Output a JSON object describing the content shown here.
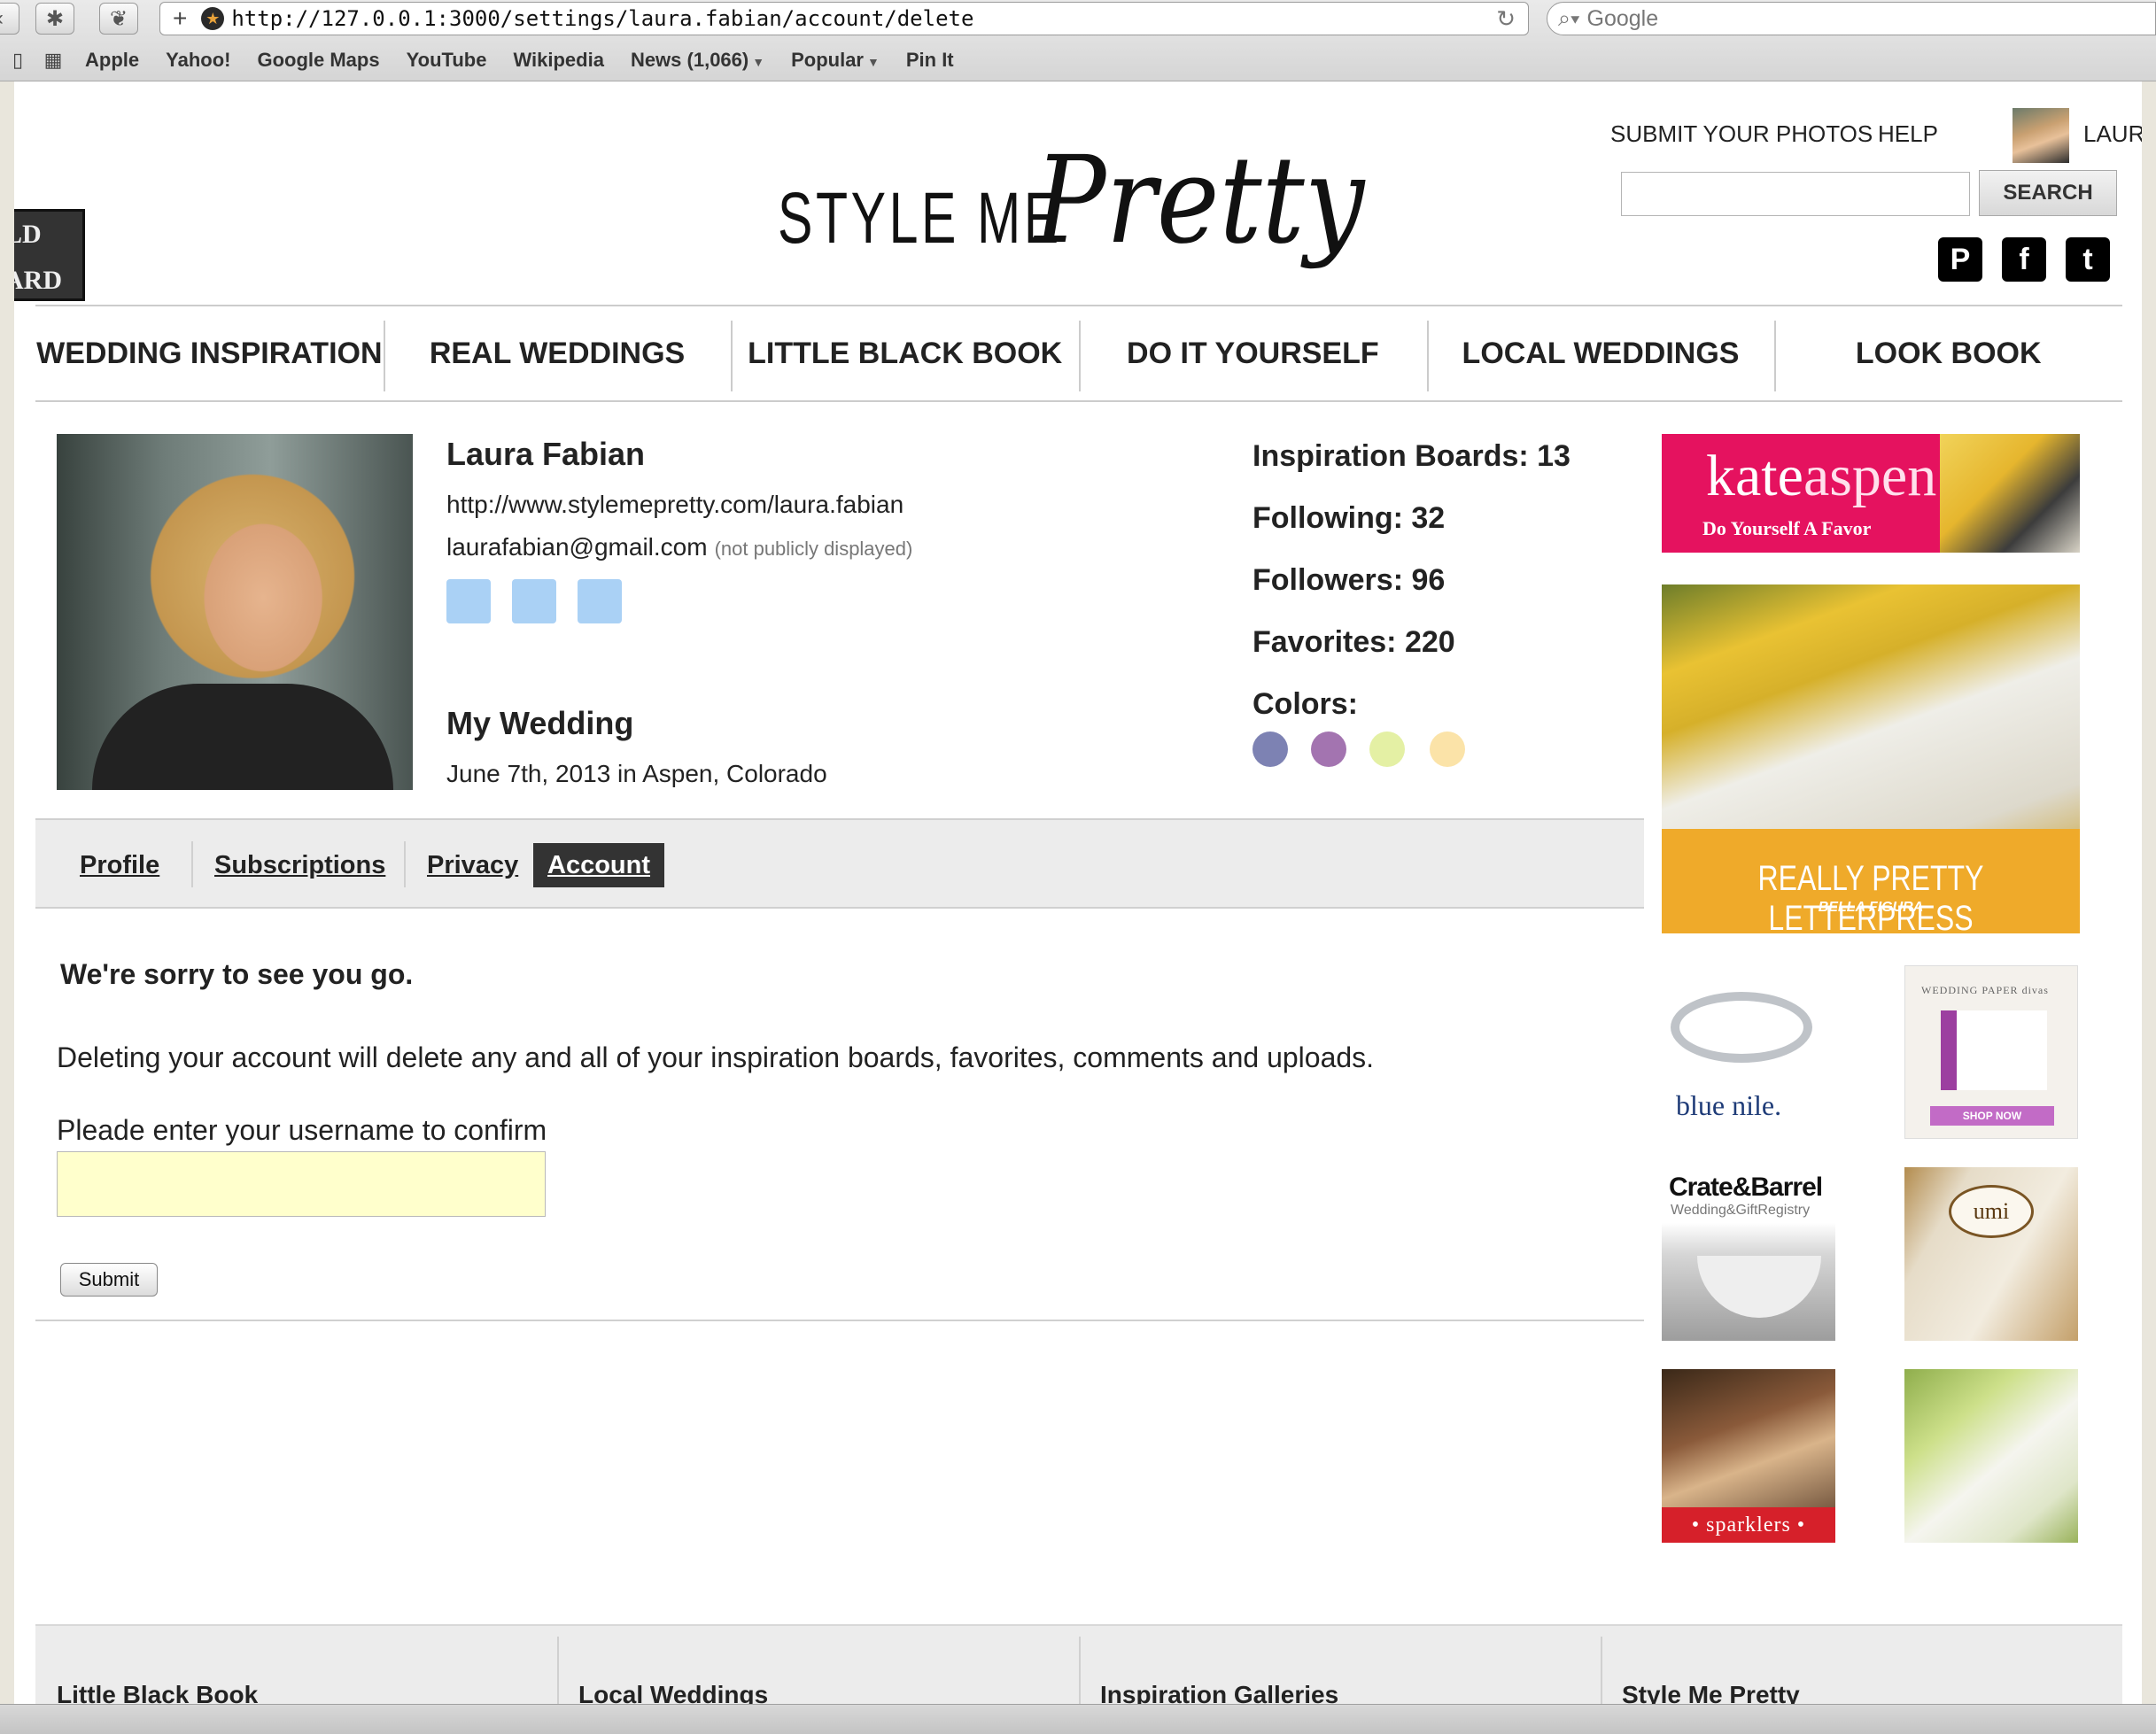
{
  "browser": {
    "url": "http://127.0.0.1:3000/settings/laura.fabian/account/delete",
    "search_placeholder": "Google",
    "bookmarks": [
      "Apple",
      "Yahoo!",
      "Google Maps",
      "YouTube",
      "Wikipedia",
      "News (1,066)",
      "Popular",
      "Pin It"
    ]
  },
  "side_badge": {
    "line1": "LD",
    "line2": "ARD"
  },
  "header": {
    "submit_photos": "SUBMIT YOUR PHOTOS",
    "help": "HELP",
    "user_name": "LAURA",
    "logo_left": "STYLE ME",
    "logo_right": "Pretty",
    "search_button": "SEARCH",
    "social": [
      "pinterest-icon",
      "facebook-icon",
      "twitter-icon"
    ]
  },
  "main_nav": [
    "WEDDING INSPIRATION",
    "REAL WEDDINGS",
    "LITTLE BLACK BOOK",
    "DO IT YOURSELF",
    "LOCAL WEDDINGS",
    "LOOK BOOK"
  ],
  "profile": {
    "name": "Laura Fabian",
    "url": "http://www.stylemepretty.com/laura.fabian",
    "email": "laurafabian@gmail.com",
    "email_note": "(not publicly displayed)",
    "my_wedding_heading": "My Wedding",
    "wedding_info": "June 7th, 2013 in Aspen, Colorado"
  },
  "stats": {
    "boards": "Inspiration Boards: 13",
    "following": "Following: 32",
    "followers": "Followers: 96",
    "favorites": "Favorites: 220",
    "colors_label": "Colors:",
    "colors": [
      "#7d82b3",
      "#a374b0",
      "#e4f0a4",
      "#fbe3a8"
    ]
  },
  "tabs": [
    "Profile",
    "Subscriptions",
    "Privacy",
    "Account"
  ],
  "active_tab": "Account",
  "delete_form": {
    "heading": "We're sorry to see you go.",
    "description": "Deleting your account will delete any and all of your inspiration boards, favorites, comments and uploads.",
    "prompt": "Pleade enter your username to confirm",
    "input_value": "",
    "submit_label": "Submit"
  },
  "ads": {
    "kate_title_a": "kate",
    "kate_title_b": "aspen",
    "kate_sub": "Do Yourself A Favor",
    "letterpress": "REALLY PRETTY LETTERPRESS",
    "letterpress_sub": "BELLA FIGURA",
    "bluenile": "blue nile.",
    "wedding_paper": "WEDDING PAPER divas",
    "wedding_paper_shop": "SHOP NOW",
    "crate_title": "Crate&Barrel",
    "crate_sub": "Wedding&GiftRegistry",
    "umi": "umi",
    "sparklers": "• sparklers •"
  },
  "footer": [
    "Little Black Book",
    "Local Weddings",
    "Inspiration Galleries",
    "Style Me Pretty"
  ]
}
